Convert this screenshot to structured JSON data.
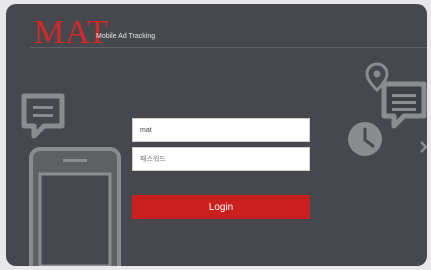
{
  "brand": {
    "logo_text": "MAT",
    "tagline": "Mobile Ad Tracking"
  },
  "login_form": {
    "username_value": "mat",
    "password_placeholder": "패스워드",
    "login_label": "Login"
  },
  "colors": {
    "panel_background": "#46484d",
    "accent_red": "#c91f1f",
    "icon_outline": "#8a8c90",
    "icon_fill": "#5a5c60"
  },
  "icons": [
    "chat-bubble-icon",
    "smartphone-icon",
    "map-pin-icon",
    "clock-icon",
    "chat-bubble-icon",
    "arrow-icon"
  ]
}
